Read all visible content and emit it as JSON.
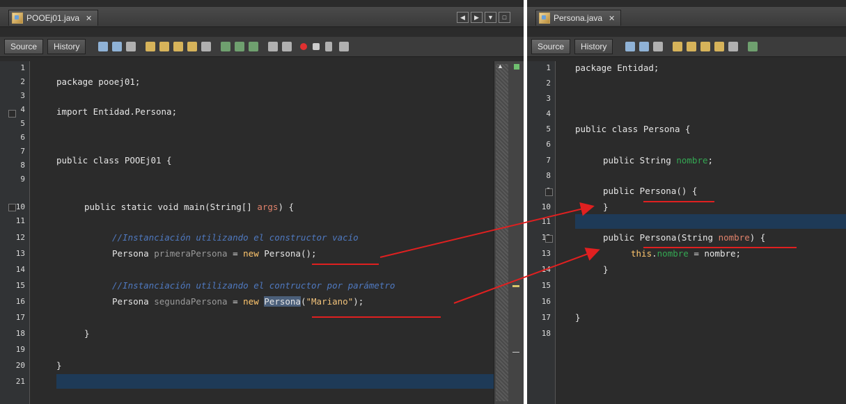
{
  "left": {
    "tab_label": "POOEj01.java",
    "source_label": "Source",
    "history_label": "History",
    "line_numbers": [
      "1",
      "2",
      "3",
      "4",
      "5",
      "6",
      "7",
      "8",
      "9",
      "10",
      "11",
      "12",
      "13",
      "14",
      "15",
      "16",
      "17",
      "18",
      "19",
      "20",
      "21"
    ],
    "code": {
      "l2": "package pooej01;",
      "l4": "import Entidad.Persona;",
      "l7": "public class POOEj01 {",
      "l10_a": "public static void main(String[] ",
      "l10_b": "args",
      "l10_c": ") {",
      "l12": "//Instanciación utilizando el constructor vacío",
      "l13_a": "Persona ",
      "l13_b": "primeraPersona",
      "l13_c": " = ",
      "l13_d": "new",
      "l13_e": " Persona();",
      "l15": "//Instanciación utilizando el contructor por parámetro",
      "l16_a": "Persona ",
      "l16_b": "segundaPersona",
      "l16_c": " = ",
      "l16_d": "new",
      "l16_e": " ",
      "l16_f": "Persona",
      "l16_g": "(",
      "l16_h": "\"Mariano\"",
      "l16_i": ");",
      "l18": "}",
      "l20": "}"
    }
  },
  "right": {
    "tab_label": "Persona.java",
    "source_label": "Source",
    "history_label": "History",
    "line_numbers": [
      "1",
      "2",
      "3",
      "4",
      "5",
      "6",
      "7",
      "8",
      "9",
      "10",
      "11",
      "12",
      "13",
      "14",
      "15",
      "16",
      "17",
      "18"
    ],
    "code": {
      "l1": "package Entidad;",
      "l5": "public class Persona {",
      "l7_a": "public String ",
      "l7_b": "nombre",
      "l7_c": ";",
      "l9": "public Persona() {",
      "l10": "}",
      "l12_a": "public Persona(String ",
      "l12_b": "nombre",
      "l12_c": ") {",
      "l13_a": "this",
      "l13_b": ".",
      "l13_c": "nombre",
      "l13_d": " = nombre;",
      "l14": "}",
      "l17": "}"
    }
  },
  "colors": {
    "editor_bg": "#2b2b2b",
    "keyword": "#ffc66d",
    "comment": "#4f79c0",
    "field": "#34a853",
    "annotation_red": "#e02020",
    "current_line": "#1e3a57"
  }
}
